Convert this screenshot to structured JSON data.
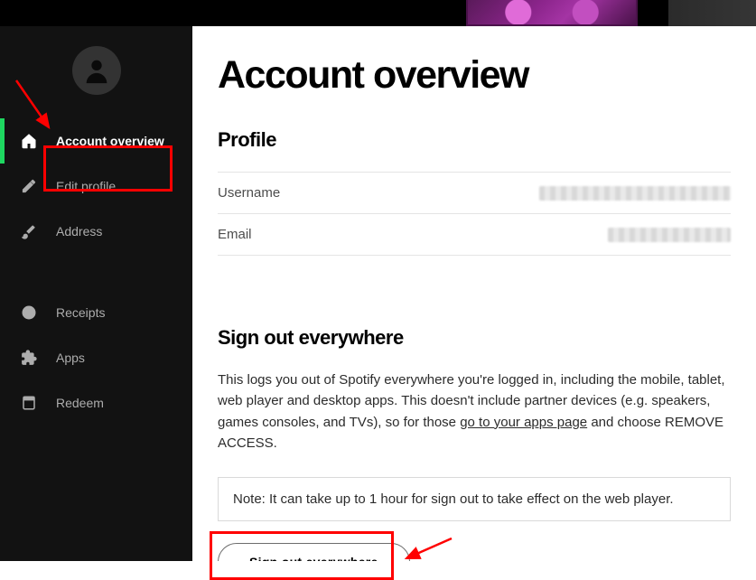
{
  "sidebar": {
    "items": [
      {
        "label": "Account overview",
        "icon": "home-icon",
        "active": true
      },
      {
        "label": "Edit profile",
        "icon": "pencil-icon"
      },
      {
        "label": "Address",
        "icon": "brush-icon"
      },
      {
        "label": "Receipts",
        "icon": "clock-icon"
      },
      {
        "label": "Apps",
        "icon": "puzzle-icon"
      },
      {
        "label": "Redeem",
        "icon": "card-icon"
      }
    ]
  },
  "page": {
    "title": "Account overview"
  },
  "profile": {
    "heading": "Profile",
    "rows": [
      {
        "label": "Username"
      },
      {
        "label": "Email"
      }
    ]
  },
  "signout": {
    "heading": "Sign out everywhere",
    "description_pre": "This logs you out of Spotify everywhere you're logged in, including the mobile, tablet, web player and desktop apps. This doesn't include partner devices (e.g. speakers, games consoles, and TVs), so for those ",
    "link_text": "go to your apps page",
    "description_post": " and choose REMOVE ACCESS.",
    "note": "Note: It can take up to 1 hour for sign out to take effect on the web player.",
    "button": "Sign out everywhere"
  }
}
